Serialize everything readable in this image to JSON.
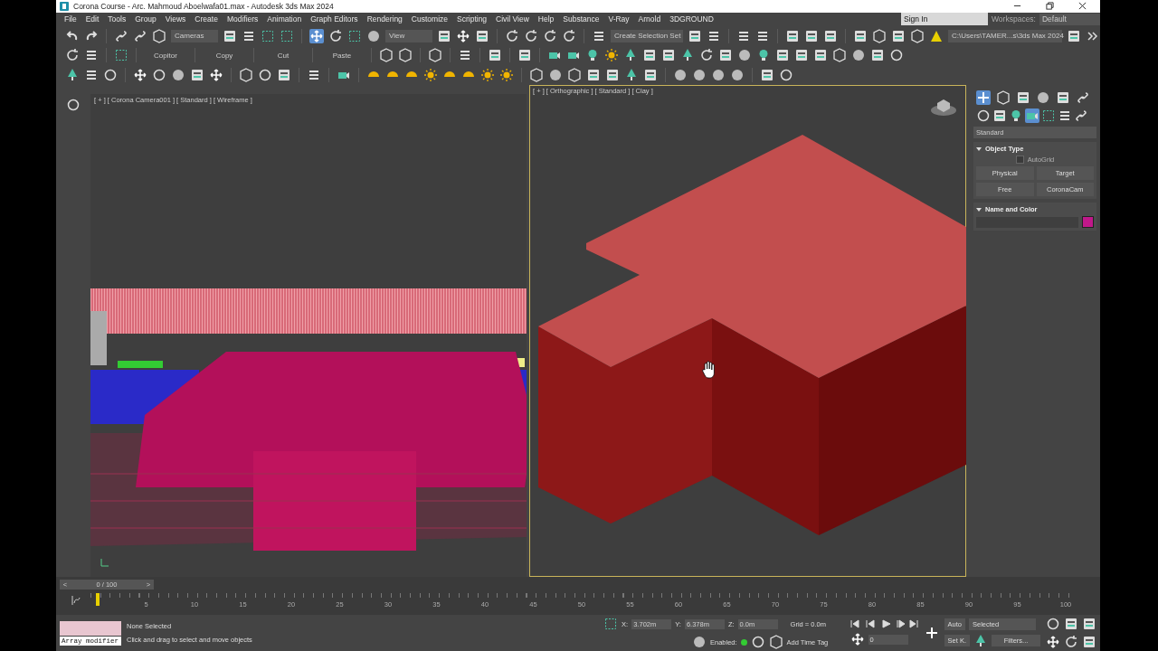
{
  "window": {
    "title": "Corona Course - Arc. Mahmoud Aboelwafa01.max - Autodesk 3ds Max 2024"
  },
  "menu": [
    "File",
    "Edit",
    "Tools",
    "Group",
    "Views",
    "Create",
    "Modifiers",
    "Animation",
    "Graph Editors",
    "Rendering",
    "Customize",
    "Scripting",
    "Civil View",
    "Help",
    "Substance",
    "V-Ray",
    "Arnold",
    "3DGROUND"
  ],
  "account": {
    "sign_in": "Sign In",
    "workspaces_label": "Workspaces:",
    "workspace": "Default"
  },
  "toolbar": {
    "cameras": "Cameras",
    "view": "View",
    "selection_set": "Create Selection Set",
    "path": "C:\\Users\\TAMER...s\\3ds Max 2024"
  },
  "secondary_toolbar": [
    "Copitor",
    "Copy",
    "Cut",
    "Paste"
  ],
  "viewports": [
    {
      "label": "[ + ] [ Corona Camera001 ] [ Standard ] [ Wireframe ]",
      "kind": "wireframe",
      "active": false
    },
    {
      "label": "[ + ] [ Orthographic ] [ Standard ] [ Clay ]",
      "kind": "clay",
      "active": true
    }
  ],
  "command_panel": {
    "tabs": [
      {
        "selected": true
      },
      {
        "selected": false
      },
      {
        "selected": false
      },
      {
        "selected": false
      },
      {
        "selected": false
      },
      {
        "selected": false
      }
    ],
    "categories": [
      {
        "selected": false
      },
      {
        "selected": false
      },
      {
        "selected": false
      },
      {
        "selected": true
      },
      {
        "selected": false
      },
      {
        "selected": false
      },
      {
        "selected": false
      }
    ],
    "dropdown": "Standard",
    "object_type": {
      "title": "Object Type",
      "expanded": true,
      "autogrid": {
        "label": "AutoGrid",
        "checked": false
      },
      "buttons": [
        "Physical",
        "Target",
        "Free",
        "CoronaCam"
      ]
    },
    "name_and_color": {
      "title": "Name and Color",
      "expanded": true,
      "color": "#c0188a"
    }
  },
  "timeline": {
    "prev": "<",
    "frame": "0 / 100",
    "next": ">",
    "level": 0,
    "ticks": [
      "5",
      "10",
      "15",
      "20",
      "25",
      "30",
      "35",
      "40",
      "45",
      "50",
      "55",
      "60",
      "65",
      "70",
      "75",
      "80",
      "85",
      "90",
      "95",
      "100"
    ]
  },
  "status": {
    "script": "Array modifier",
    "selection": "None Selected",
    "prompt": "Click and drag to select and move objects",
    "x_label": "X:",
    "x": "3.702m",
    "y_label": "Y:",
    "y": "6.378m",
    "z_label": "Z:",
    "z": "0.0m",
    "grid": "Grid = 0.0m",
    "enabled_label": "Enabled:",
    "time_tag": "Add Time Tag",
    "auto": "Auto",
    "set_key": "Set K.",
    "key_filter": "Selected",
    "filters": "Filters...",
    "frame": "0"
  }
}
